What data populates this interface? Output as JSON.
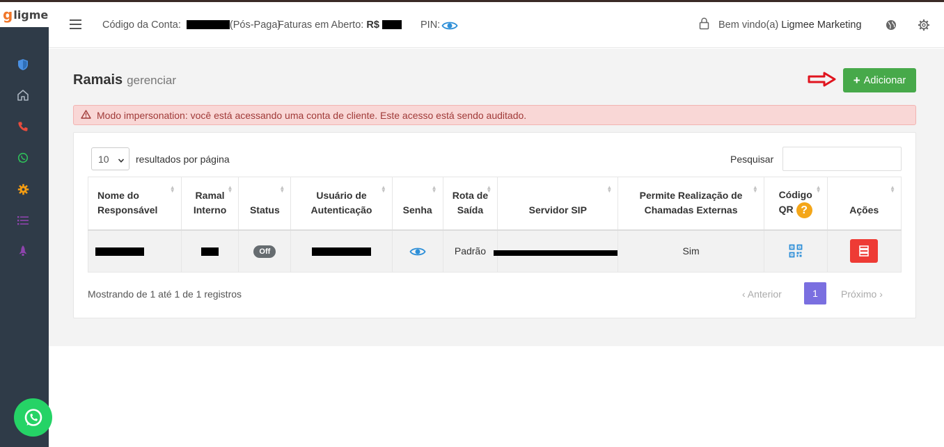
{
  "brand": {
    "logo_g": "g",
    "logo_text": "ligmee"
  },
  "header": {
    "account_label": "Código da Conta:",
    "account_suffix": "(Pós-Paga)",
    "invoices_label": "Faturas em Aberto:",
    "invoices_currency": "R$",
    "pin_label": "PIN:",
    "welcome_label": "Bem vindo(a)",
    "welcome_user": "Ligmee Marketing"
  },
  "sidebar": {
    "items": [
      {
        "icon": "shield-icon",
        "color": "#4a90e2"
      },
      {
        "icon": "home-icon",
        "color": "#aab4c0"
      },
      {
        "icon": "phone-icon",
        "color": "#e84c3d"
      },
      {
        "icon": "whatsapp-icon",
        "color": "#2fbf5a"
      },
      {
        "icon": "gear-icon",
        "color": "#f39c12"
      },
      {
        "icon": "list-icon",
        "color": "#8e44ad"
      },
      {
        "icon": "rocket-icon",
        "color": "#8e44ad"
      }
    ]
  },
  "page": {
    "title": "Ramais",
    "subtitle": "gerenciar",
    "add_button": "Adicionar",
    "alert": "Modo impersonation: você está acessando uma conta de cliente. Este acesso está sendo auditado."
  },
  "table_controls": {
    "per_page_value": "10",
    "per_page_label": "resultados por página",
    "search_label": "Pesquisar",
    "search_value": ""
  },
  "table": {
    "headers": [
      {
        "line1": "Nome do",
        "line2": "Responsável"
      },
      {
        "line1": "Ramal",
        "line2": "Interno"
      },
      {
        "line1": "",
        "line2": "Status"
      },
      {
        "line1": "Usuário de",
        "line2": "Autenticação"
      },
      {
        "line1": "",
        "line2": "Senha"
      },
      {
        "line1": "Rota de",
        "line2": "Saída"
      },
      {
        "line1": "",
        "line2": "Servidor SIP"
      },
      {
        "line1": "Permite Realização de",
        "line2": "Chamadas Externas"
      },
      {
        "line1": "Código",
        "line2": "QR"
      },
      {
        "line1": "",
        "line2": "Ações"
      }
    ],
    "rows": [
      {
        "status": "Off",
        "route": "Padrão",
        "external_calls": "Sim"
      }
    ]
  },
  "footer": {
    "info": "Mostrando de 1 até 1 de 1 registros",
    "prev": "Anterior",
    "current_page": "1",
    "next": "Próximo"
  },
  "colors": {
    "accent_green": "#47a94a",
    "alert_bg": "#f9d7d6",
    "sidebar_bg": "#2f3b48",
    "pagination_active": "#7a6fe0",
    "danger": "#ee3b35"
  }
}
